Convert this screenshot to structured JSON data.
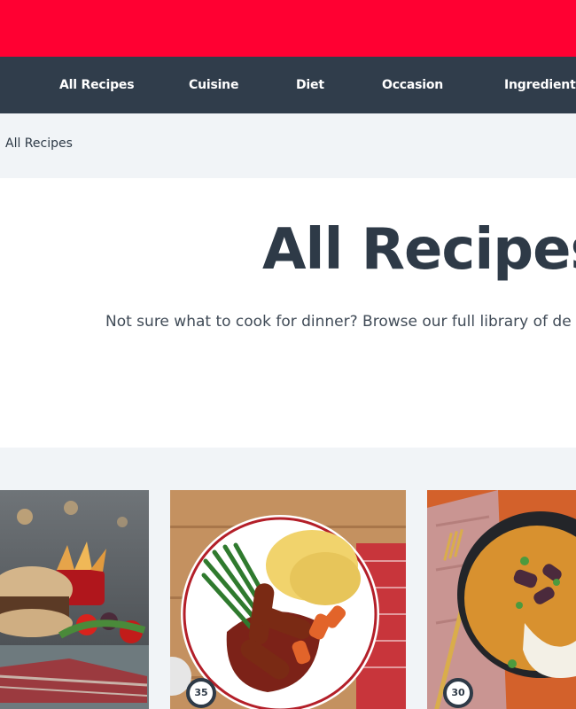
{
  "nav": {
    "items": [
      {
        "label": "All Recipes"
      },
      {
        "label": "Cuisine"
      },
      {
        "label": "Diet"
      },
      {
        "label": "Occasion"
      },
      {
        "label": "Ingredient"
      }
    ]
  },
  "breadcrumb": {
    "current": "All Recipes"
  },
  "hero": {
    "title": "All Recipes",
    "description": "Not sure what to cook for dinner? Browse our full library of de"
  },
  "recipes": [
    {
      "time": ""
    },
    {
      "time": "35"
    },
    {
      "time": "30"
    }
  ],
  "colors": {
    "brand_red": "#ff0032",
    "nav_bg": "#303d4b",
    "page_bg": "#f1f4f7",
    "text_dark": "#2e3a47"
  },
  "icons": {
    "time_badge": "cooking-time-ring-icon"
  }
}
